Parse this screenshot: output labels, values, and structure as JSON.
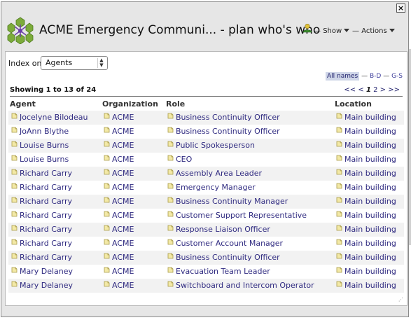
{
  "window": {
    "title": "ACME Emergency Communi... - plan who's who",
    "close_label": "×",
    "menus": {
      "show": "Show",
      "actions": "Actions",
      "separator": "—"
    }
  },
  "index": {
    "label": "Index on",
    "selected": "Agents"
  },
  "names_filter": {
    "all": "All names",
    "sep": "—",
    "bd": "B-D",
    "gs": "G-S"
  },
  "listing": {
    "showing": "Showing 1 to 13 of 24",
    "pager": {
      "first": "<<",
      "prev": "<",
      "page1": "1",
      "page2": "2",
      "next": ">",
      "last": ">>"
    }
  },
  "columns": {
    "agent": "Agent",
    "organization": "Organization",
    "role": "Role",
    "location": "Location"
  },
  "rows": [
    {
      "agent": "Jocelyne Bilodeau",
      "org": "ACME",
      "role": "Business Continuity Officer",
      "location": "Main building"
    },
    {
      "agent": "JoAnn Blythe",
      "org": "ACME",
      "role": "Business Continuity Officer",
      "location": "Main building"
    },
    {
      "agent": "Louise Burns",
      "org": "ACME",
      "role": "Public Spokesperson",
      "location": "Main building"
    },
    {
      "agent": "Louise Burns",
      "org": "ACME",
      "role": "CEO",
      "location": "Main building"
    },
    {
      "agent": "Richard Carry",
      "org": "ACME",
      "role": "Assembly Area Leader",
      "location": "Main building"
    },
    {
      "agent": "Richard Carry",
      "org": "ACME",
      "role": "Emergency Manager",
      "location": "Main building"
    },
    {
      "agent": "Richard Carry",
      "org": "ACME",
      "role": "Business Continuity Manager",
      "location": "Main building"
    },
    {
      "agent": "Richard Carry",
      "org": "ACME",
      "role": "Customer Support Representative",
      "location": "Main building"
    },
    {
      "agent": "Richard Carry",
      "org": "ACME",
      "role": "Response Liaison Officer",
      "location": "Main building"
    },
    {
      "agent": "Richard Carry",
      "org": "ACME",
      "role": "Customer Account Manager",
      "location": "Main building"
    },
    {
      "agent": "Richard Carry",
      "org": "ACME",
      "role": "Business Continuity Officer",
      "location": "Main building"
    },
    {
      "agent": "Mary Delaney",
      "org": "ACME",
      "role": "Evacuation Team Leader",
      "location": "Main building"
    },
    {
      "agent": "Mary Delaney",
      "org": "ACME",
      "role": "Switchboard and Intercom Operator",
      "location": "Main building"
    }
  ],
  "icons": {
    "logo": "network-gear-logo-icon",
    "user": "user-icon",
    "entity": "sticky-note-icon",
    "resize": "resize-grip-icon"
  },
  "colors": {
    "link": "#2f2a80",
    "panel_bg": "#e6e6e6",
    "active_filter": "#cfd6e8"
  }
}
